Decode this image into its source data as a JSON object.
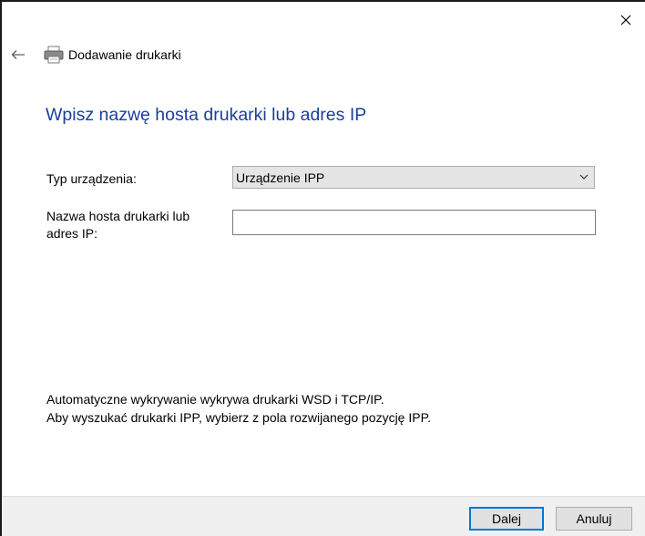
{
  "window": {
    "title": "Dodawanie drukarki"
  },
  "page": {
    "heading": "Wpisz nazwę hosta drukarki lub adres IP"
  },
  "form": {
    "device_type_label": "Typ urządzenia:",
    "device_type_value": "Urządzenie IPP",
    "host_label_line1": "Nazwa hosta drukarki lub",
    "host_label_line2": "adres IP:",
    "host_value": ""
  },
  "info": {
    "line1": "Automatyczne wykrywanie wykrywa drukarki WSD i TCP/IP.",
    "line2": "Aby wyszukać drukarki IPP, wybierz z pola rozwijanego pozycję IPP."
  },
  "buttons": {
    "next_label": "Dalej",
    "cancel_label": "Anuluj"
  },
  "colors": {
    "heading": "#1a3f9b",
    "focus_border": "#0078d7",
    "footer_bg": "#f0f0f0"
  }
}
